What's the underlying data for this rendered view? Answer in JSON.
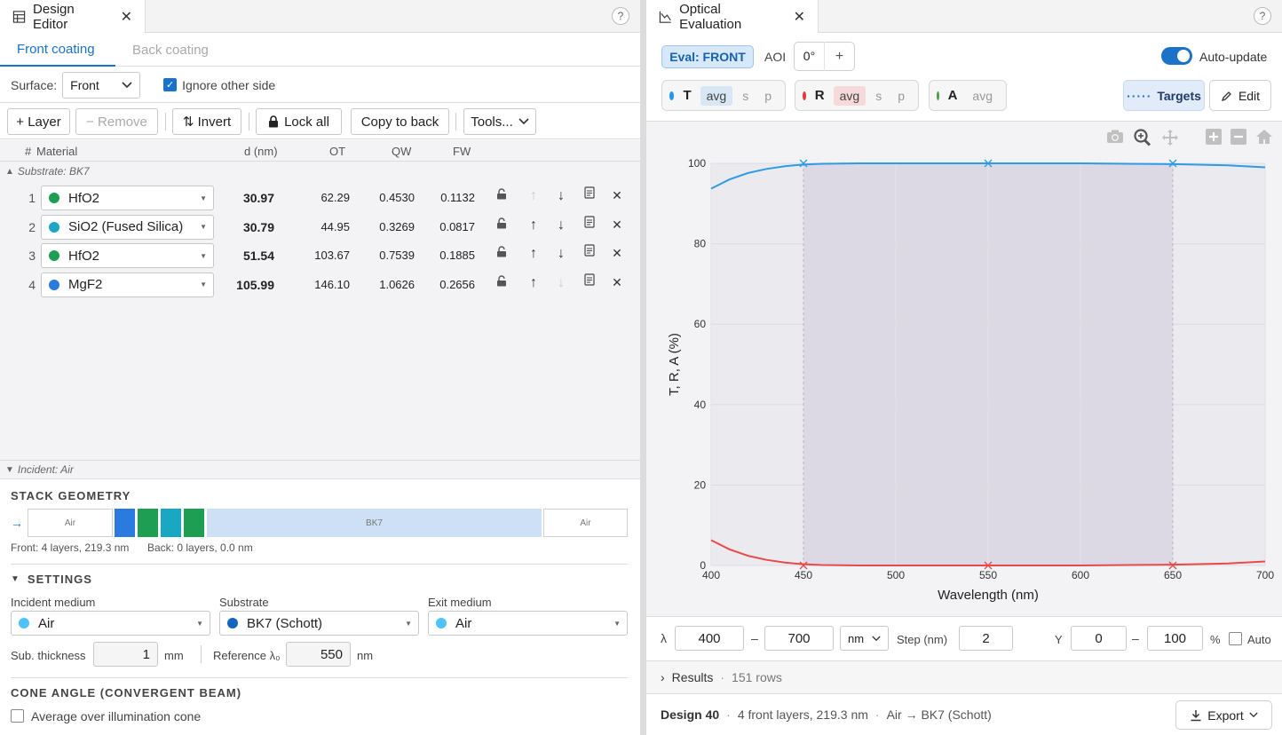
{
  "design_editor": {
    "tab_title": "Design Editor",
    "help": "?",
    "subtabs": [
      "Front coating",
      "Back coating"
    ],
    "surface": {
      "label": "Surface:",
      "value": "Front",
      "ignore_label": "Ignore other side",
      "ignore_checked": true
    },
    "toolbar": {
      "add": "+ Layer",
      "remove": "− Remove",
      "invert": "⇅ Invert",
      "lock": "Lock all",
      "copy": "Copy to back",
      "tools": "Tools..."
    },
    "table": {
      "headers": {
        "num": "#",
        "material": "Material",
        "d": "d (nm)",
        "ot": "OT",
        "qw": "QW",
        "fw": "FW"
      },
      "substrate_label": "Substrate: BK7",
      "rows": [
        {
          "n": "1",
          "material": "HfO2",
          "color": "#1e9e52",
          "d": "30.97",
          "ot": "62.29",
          "qw": "0.4530",
          "fw": "0.1132",
          "up_dim": true,
          "down_dim": false
        },
        {
          "n": "2",
          "material": "SiO2 (Fused Silica)",
          "color": "#1aa7c4",
          "d": "30.79",
          "ot": "44.95",
          "qw": "0.3269",
          "fw": "0.0817",
          "up_dim": false,
          "down_dim": false
        },
        {
          "n": "3",
          "material": "HfO2",
          "color": "#1e9e52",
          "d": "51.54",
          "ot": "103.67",
          "qw": "0.7539",
          "fw": "0.1885",
          "up_dim": false,
          "down_dim": false
        },
        {
          "n": "4",
          "material": "MgF2",
          "color": "#2a7ae0",
          "d": "105.99",
          "ot": "146.10",
          "qw": "1.0626",
          "fw": "0.2656",
          "up_dim": false,
          "down_dim": true
        }
      ]
    },
    "incident_label": "Incident: Air",
    "stack_geometry": {
      "title": "STACK GEOMETRY",
      "arrow": "→",
      "left_medium": "Air",
      "substrate": "BK7",
      "right_medium": "Air",
      "layer_colors": [
        "#2a7ae0",
        "#1e9e52",
        "#1aa7c4",
        "#1e9e52"
      ],
      "front_info": "Front: 4 layers, 219.3 nm",
      "back_info": "Back: 0 layers, 0.0 nm"
    },
    "settings": {
      "title": "SETTINGS",
      "incident_label": "Incident medium",
      "incident_value": "Air",
      "substrate_label": "Substrate",
      "substrate_value": "BK7 (Schott)",
      "exit_label": "Exit medium",
      "exit_value": "Air",
      "thickness_label": "Sub. thickness",
      "thickness_value": "1",
      "thickness_unit": "mm",
      "ref_label": "Reference λ₀",
      "ref_value": "550",
      "ref_unit": "nm"
    },
    "cone": {
      "title": "CONE ANGLE (CONVERGENT BEAM)",
      "avg_label": "Average over illumination cone",
      "avg_checked": false
    }
  },
  "optical_evaluation": {
    "tab_title": "Optical Evaluation",
    "help": "?",
    "eval_badge": "Eval: FRONT",
    "aoi_label": "AOI",
    "aoi_value": "0°",
    "aoi_plus": "+",
    "auto_update_label": "Auto-update",
    "auto_update_on": true,
    "channels": {
      "T": {
        "label": "T",
        "opts": [
          "avg",
          "s",
          "p"
        ],
        "color": "#2196f3"
      },
      "R": {
        "label": "R",
        "opts": [
          "avg",
          "s",
          "p"
        ],
        "color": "#e53935"
      },
      "A": {
        "label": "A",
        "opts": [
          "avg"
        ],
        "color": "#43a047"
      }
    },
    "targets_label": "Targets",
    "edit_label": "Edit",
    "range": {
      "lambda_label": "λ",
      "lambda_min": "400",
      "dash": "–",
      "lambda_max": "700",
      "unit": "nm",
      "step_label": "Step (nm)",
      "step_value": "2",
      "y_label": "Y",
      "y_min": "0",
      "y_max": "100",
      "pct": "%",
      "auto_label": "Auto"
    },
    "results_label": "Results",
    "results_count": "151 rows",
    "status": {
      "design": "Design 40",
      "layers": "4 front layers, 219.3 nm",
      "path": "Air → BK7 (Schott)",
      "export": "Export"
    }
  },
  "chart_data": {
    "type": "line",
    "xlabel": "Wavelength (nm)",
    "ylabel": "T, R, A (%)",
    "xlim": [
      400,
      700
    ],
    "ylim": [
      0,
      100
    ],
    "xticks": [
      400,
      450,
      500,
      550,
      600,
      650,
      700
    ],
    "yticks": [
      0,
      20,
      40,
      60,
      80,
      100
    ],
    "grid": true,
    "target_band": [
      450,
      650
    ],
    "target_markers_x": [
      450,
      550,
      650
    ],
    "series": [
      {
        "name": "T",
        "color": "#2d9be6",
        "x": [
          400,
          410,
          420,
          430,
          440,
          450,
          460,
          480,
          500,
          550,
          600,
          650,
          680,
          700
        ],
        "y": [
          93.7,
          96.0,
          97.6,
          98.6,
          99.3,
          99.7,
          99.9,
          100,
          100,
          100,
          100,
          99.8,
          99.5,
          99.0
        ]
      },
      {
        "name": "R",
        "color": "#e84a4a",
        "x": [
          400,
          410,
          420,
          430,
          440,
          450,
          460,
          480,
          500,
          550,
          600,
          650,
          680,
          700
        ],
        "y": [
          6.3,
          4.0,
          2.4,
          1.4,
          0.7,
          0.3,
          0.1,
          0,
          0,
          0,
          0,
          0.2,
          0.5,
          1.0
        ]
      }
    ]
  }
}
